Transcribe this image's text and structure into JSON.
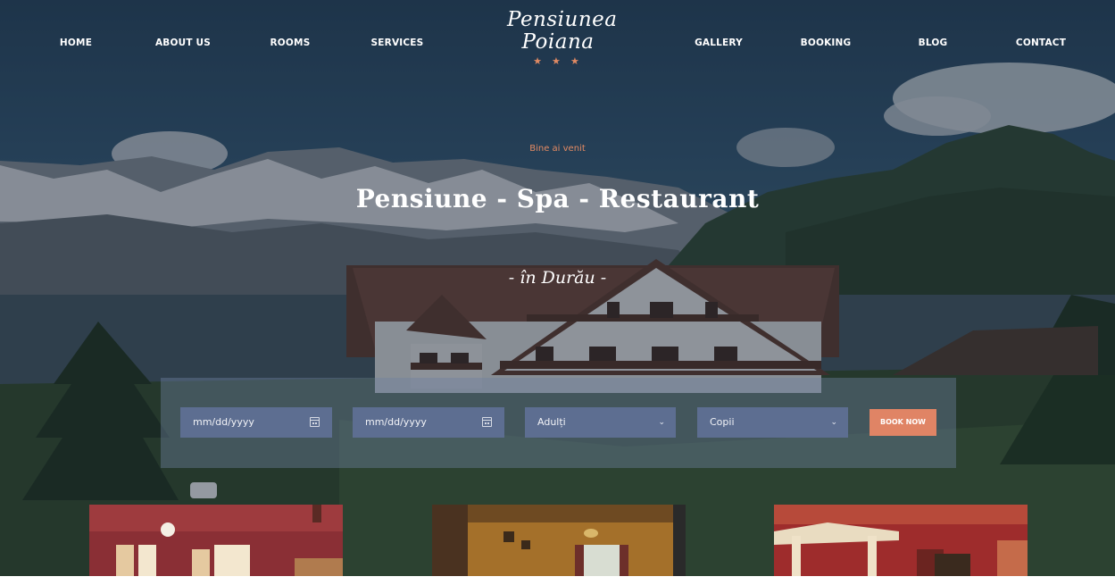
{
  "nav": {
    "left": [
      "HOME",
      "ABOUT US",
      "ROOMS",
      "SERVICES"
    ],
    "right": [
      "GALLERY",
      "BOOKING",
      "BLOG",
      "CONTACT"
    ]
  },
  "logo": {
    "line1": "Pensiunea",
    "line2": "Poiana",
    "stars": "★ ★ ★"
  },
  "hero": {
    "welcome": "Bine ai venit",
    "headline": "Pensiune - Spa - Restaurant",
    "subtitle": "- în Durău -"
  },
  "booking": {
    "checkin_placeholder": "mm/dd/yyyy",
    "checkout_placeholder": "mm/dd/yyyy",
    "adults_label": "Adulți",
    "children_label": "Copii",
    "button_label": "BOOK NOW"
  },
  "icons": {
    "calendar": "calendar-icon",
    "dropdown": "chevron-down-icon"
  },
  "colors": {
    "accent": "#e08465",
    "field": "#5d6e91",
    "booking_panel": "rgba(110,128,160,0.42)"
  }
}
